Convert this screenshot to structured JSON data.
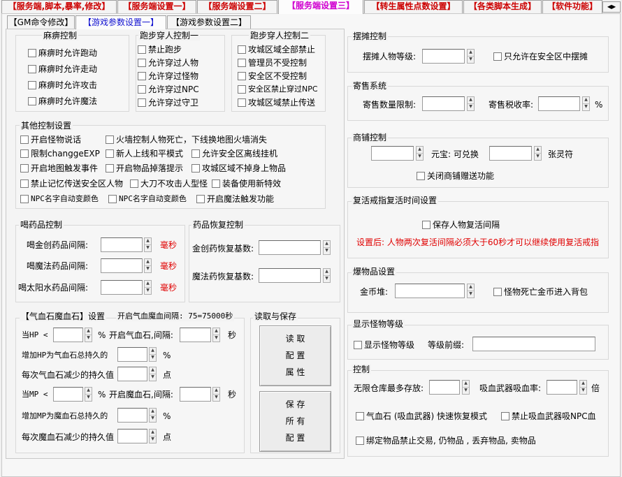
{
  "top_tabs": [
    "【服务端,脚本,暴率,修改】",
    "【服务端设置一】",
    "【服务端设置二】",
    "【服务端设置三】",
    "【转生属性点数设置】",
    "【各类脚本生成】",
    "【软件功能】"
  ],
  "sub_tabs": [
    "【GM命令修改】",
    "【游戏参数设置一】",
    "【游戏参数设置二】"
  ],
  "paralysis": {
    "title": "麻痹控制",
    "items": [
      "麻痹时允许跑动",
      "麻痹时允许走动",
      "麻痹时允许攻击",
      "麻痹时允许魔法"
    ]
  },
  "cross1": {
    "title": "跑步穿人控制一",
    "items": [
      "禁止跑步",
      "允许穿过人物",
      "允许穿过怪物",
      "允许穿过NPC",
      "允许穿过守卫"
    ]
  },
  "cross2": {
    "title": "跑步穿人控制二",
    "items": [
      "攻城区域全部禁止",
      "管理员不受控制",
      "安全区不受控制",
      "安全区禁止穿过NPC",
      "攻城区域禁止传送"
    ]
  },
  "other": {
    "title": "其他控制设置",
    "items": [
      "开启怪物说话",
      "火墙控制人物死亡，下线换地图火墙消失",
      "限制changgeEXP",
      "新人上线和平模式",
      "允许安全区离线挂机",
      "开启地图触发事件",
      "开启物品掉落提示",
      "攻城区域不掉身上物品",
      "禁止记忆传送安全区人物",
      "大刀不攻击人型怪",
      "装备使用新特效",
      "NPC名字自动变颜色",
      "NPC名字自动变颜色",
      "开启魔法触发功能"
    ]
  },
  "potion": {
    "title": "喝药品控制",
    "rows": [
      "喝金创药品间隔:",
      "喝魔法药品间隔:",
      "喝太阳水药品间隔:"
    ],
    "unit": "毫秒"
  },
  "recover": {
    "title": "药品恢复控制",
    "rows": [
      "金创药恢复基数:",
      "魔法药恢复基数:"
    ]
  },
  "stone": {
    "title": "【气血石魔血石】设置",
    "interval": "开启气血魔血间隔: 75=75000秒",
    "hp_lt": "当HP <",
    "pct": "%",
    "open_hp": "开启气血石,间隔:",
    "sec": "秒",
    "hp_add": "增加HP为气血石总持久的",
    "hp_dec": "每次气血石减少的持久值",
    "pt": "点",
    "mp_lt": "当MP <",
    "open_mp": "开启魔血石,间隔:",
    "mp_add": "增加MP为魔血石总持久的",
    "mp_dec": "每次魔血石减少的持久值"
  },
  "rw": {
    "title": "读取与保存",
    "read": [
      "读 取",
      "配 置",
      "属 性"
    ],
    "save": [
      "保 存",
      "所 有",
      "配 置"
    ]
  },
  "stall": {
    "title": "摆摊控制",
    "level": "摆摊人物等级:",
    "safe": "只允许在安全区中摆摊"
  },
  "consign": {
    "title": "寄售系统",
    "limit": "寄售数量限制:",
    "tax": "寄售税收率:",
    "pct": "%"
  },
  "shop": {
    "title": "商铺控制",
    "yb": "元宝: 可兑换",
    "talisman": "张灵符",
    "close": "关闭商铺赠送功能"
  },
  "revive": {
    "title": "复活戒指复活时间设置",
    "save": "保存人物复活间隔",
    "note": "设置后: 人物两次复活间隔必须大于60秒才可以继续使用复活戒指"
  },
  "drop": {
    "title": "爆物品设置",
    "gold": "金币堆:",
    "bag": "怪物死亡金币进入背包"
  },
  "mon": {
    "title": "显示怪物等级",
    "show": "显示怪物等级",
    "prefix": "等级前缀:"
  },
  "ctrl": {
    "title": "控制",
    "store": "无限仓库最多存放:",
    "vamp": "吸血武器吸血率:",
    "times": "倍",
    "fast": "气血石 (吸血武器) 快速恢复模式",
    "nonpc": "禁止吸血武器吸NPC血",
    "bind": "绑定物品禁止交易, 仍物品 , 丢弃物品,  卖物品"
  },
  "colors": {
    "tab_text": "#cc0000",
    "active_tab": "#d000d0",
    "active_sub": "#1010d0",
    "warn": "#e00000"
  }
}
